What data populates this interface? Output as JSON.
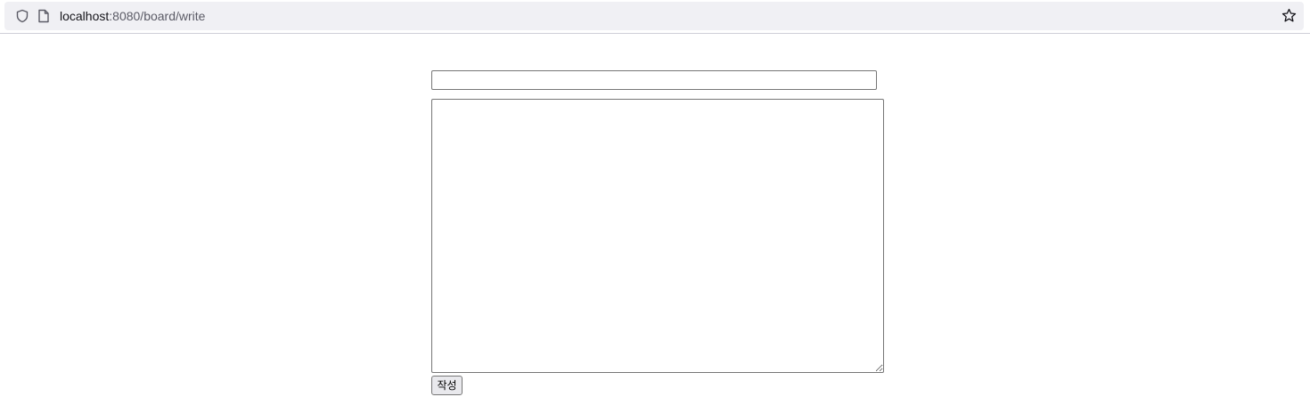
{
  "browser": {
    "url_host": "localhost",
    "url_rest": ":8080/board/write",
    "icons": {
      "security": "shield-icon",
      "page": "page-icon",
      "bookmark": "star-icon"
    }
  },
  "form": {
    "title_value": "",
    "content_value": "",
    "submit_label": "작성"
  }
}
